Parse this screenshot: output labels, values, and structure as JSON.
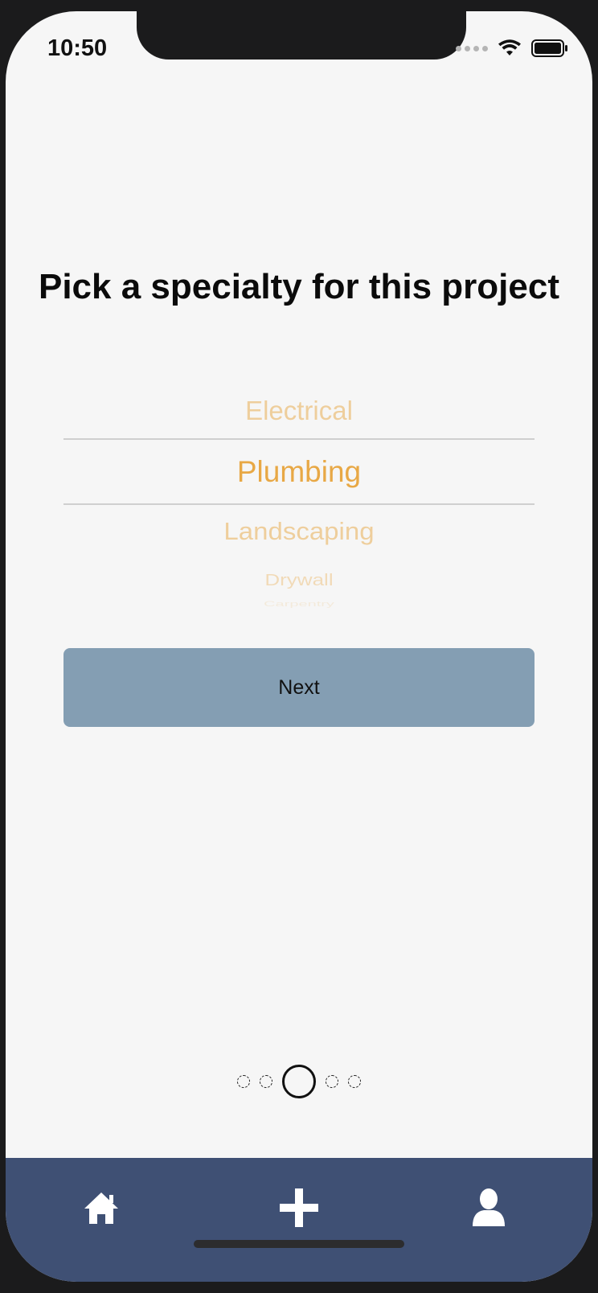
{
  "status_bar": {
    "time": "10:50"
  },
  "screen": {
    "title": "Pick a specialty for this project",
    "picker": {
      "selected": "Plumbing",
      "items": [
        "Electrical",
        "Plumbing",
        "Landscaping",
        "Drywall",
        "Carpentry"
      ]
    },
    "next_label": "Next"
  },
  "pagination": {
    "total": 5,
    "current": 3
  },
  "tab_bar": {
    "items": [
      "home-icon",
      "add-icon",
      "profile-icon"
    ]
  },
  "colors": {
    "accent": "#e8a845",
    "button": "#849eb3",
    "tab_bar": "#3f5074",
    "background": "#f6f6f6"
  }
}
